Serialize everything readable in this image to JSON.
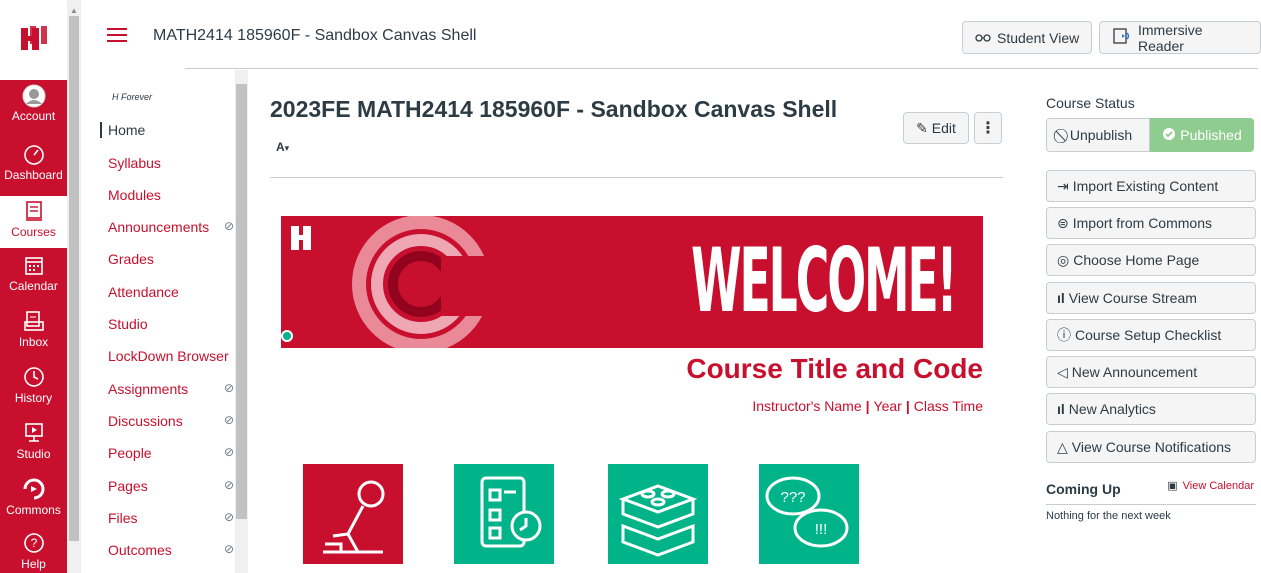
{
  "global_nav": {
    "items": [
      {
        "label": "Account",
        "icon": "account-icon"
      },
      {
        "label": "Dashboard",
        "icon": "dashboard-icon"
      },
      {
        "label": "Courses",
        "icon": "courses-icon"
      },
      {
        "label": "Calendar",
        "icon": "calendar-icon"
      },
      {
        "label": "Inbox",
        "icon": "inbox-icon"
      },
      {
        "label": "History",
        "icon": "history-icon"
      },
      {
        "label": "Studio",
        "icon": "studio-icon"
      },
      {
        "label": "Commons",
        "icon": "commons-icon"
      },
      {
        "label": "Help",
        "icon": "help-icon"
      }
    ],
    "brand_color": "#c8102e"
  },
  "topbar": {
    "breadcrumb": "MATH2414 185960F - Sandbox Canvas Shell",
    "student_view": "Student View",
    "immersive_reader": "Immersive Reader"
  },
  "course_nav": {
    "subtitle": "H Forever",
    "items": [
      {
        "label": "Home",
        "hidden": false
      },
      {
        "label": "Syllabus",
        "hidden": false
      },
      {
        "label": "Modules",
        "hidden": false
      },
      {
        "label": "Announcements",
        "hidden": true
      },
      {
        "label": "Grades",
        "hidden": false
      },
      {
        "label": "Attendance",
        "hidden": false
      },
      {
        "label": "Studio",
        "hidden": false
      },
      {
        "label": "LockDown Browser",
        "hidden": false
      },
      {
        "label": "Assignments",
        "hidden": true
      },
      {
        "label": "Discussions",
        "hidden": true
      },
      {
        "label": "People",
        "hidden": true
      },
      {
        "label": "Pages",
        "hidden": true
      },
      {
        "label": "Files",
        "hidden": true
      },
      {
        "label": "Outcomes",
        "hidden": true
      }
    ]
  },
  "main": {
    "title": "2023FE MATH2414 185960F - Sandbox Canvas Shell",
    "edit_label": "Edit",
    "banner_text": "WELCOME!",
    "course_title": "Course Title and Code",
    "instructor": "Instructor's Name",
    "year": "Year",
    "class_time": "Class Time",
    "tile_colors": [
      "#c8102e",
      "#00b388",
      "#00b388",
      "#00b388"
    ]
  },
  "sidebar": {
    "status_label": "Course Status",
    "unpublish": "Unpublish",
    "published": "Published",
    "buttons": [
      {
        "label": "Import Existing Content",
        "icon": "import-icon"
      },
      {
        "label": "Import from Commons",
        "icon": "commons-icon"
      },
      {
        "label": "Choose Home Page",
        "icon": "target-icon"
      },
      {
        "label": "View Course Stream",
        "icon": "bar-chart-icon"
      },
      {
        "label": "Course Setup Checklist",
        "icon": "question-icon"
      },
      {
        "label": "New Announcement",
        "icon": "megaphone-icon"
      },
      {
        "label": "New Analytics",
        "icon": "bar-chart-icon"
      },
      {
        "label": "View Course Notifications",
        "icon": "bell-icon"
      }
    ],
    "coming_up": "Coming Up",
    "view_calendar": "View Calendar",
    "nothing": "Nothing for the next week"
  }
}
